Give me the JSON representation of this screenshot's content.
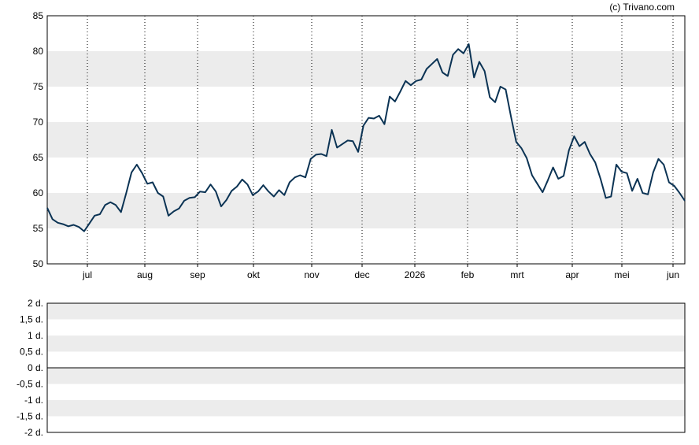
{
  "copyright": "(c) Trivano.com",
  "chart_data": [
    {
      "type": "line",
      "x_tick_labels": [
        "jul",
        "aug",
        "sep",
        "okt",
        "nov",
        "dec",
        "2026",
        "feb",
        "mrt",
        "apr",
        "mei",
        "jun"
      ],
      "y_ticks": [
        85,
        80,
        75,
        70,
        65,
        60,
        55,
        50
      ],
      "ylim": [
        50,
        85
      ],
      "grid": "alternating horizontal bands, dotted vertical lines at month starts",
      "line_color": "#0b3354",
      "series": [
        {
          "values": [
            57.9,
            56.3,
            55.8,
            55.6,
            55.3,
            55.5,
            55.2,
            54.6,
            55.7,
            56.8,
            57.0,
            58.3,
            58.7,
            58.3,
            57.3,
            60.0,
            62.9,
            64.0,
            62.8,
            61.3,
            61.5,
            60.0,
            59.5,
            56.8,
            57.4,
            57.8,
            58.9,
            59.3,
            59.4,
            60.2,
            60.1,
            61.2,
            60.2,
            58.1,
            59.0,
            60.3,
            60.9,
            61.9,
            61.2,
            59.7,
            60.2,
            61.1,
            60.2,
            59.5,
            60.4,
            59.7,
            61.5,
            62.2,
            62.5,
            62.2,
            64.8,
            65.4,
            65.5,
            65.2,
            68.9,
            66.4,
            66.9,
            67.4,
            67.3,
            65.8,
            69.5,
            70.6,
            70.5,
            70.9,
            69.7,
            73.6,
            72.9,
            74.3,
            75.8,
            75.2,
            75.8,
            76.0,
            77.5,
            78.2,
            78.9,
            77.0,
            76.5,
            79.5,
            80.3,
            79.7,
            81.0,
            76.3,
            78.5,
            77.2,
            73.5,
            72.8,
            75.0,
            74.6,
            70.8,
            67.2,
            66.3,
            64.9,
            62.5,
            61.3,
            60.1,
            61.8,
            63.6,
            62.0,
            62.4,
            66.0,
            68.0,
            66.6,
            67.2,
            65.5,
            64.3,
            62.0,
            59.3,
            59.5,
            64.0,
            63.0,
            62.8,
            60.3,
            62.0,
            60.0,
            59.8,
            62.9,
            64.8,
            64.0,
            61.5,
            61.0,
            60.0,
            58.9
          ]
        }
      ]
    },
    {
      "type": "line",
      "y_tick_labels": [
        "2 d.",
        "1,5 d.",
        "1 d.",
        "0,5 d.",
        "0 d.",
        "-0,5 d.",
        "-1 d.",
        "-1,5 d.",
        "-2 d."
      ],
      "ylim": [
        -2,
        2
      ],
      "zero_line": true,
      "grid": "alternating horizontal bands"
    }
  ]
}
